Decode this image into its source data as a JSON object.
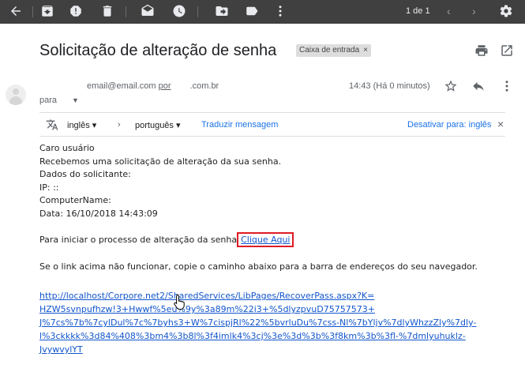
{
  "toolbar": {
    "icons": [
      "back-arrow-icon",
      "archive-icon",
      "report-spam-icon",
      "delete-icon",
      "mark-unread-icon",
      "snooze-icon",
      "move-to-icon",
      "labels-icon",
      "more-icon",
      "settings-icon"
    ],
    "pager": "1 de 1"
  },
  "email": {
    "subject": "Solicitação de alteração de senha",
    "label": "Caixa de entrada",
    "label_remove": "×",
    "sender_email": "email@email.com",
    "sender_via": "por",
    "sender_domain": ".com.br",
    "to_label": "para",
    "time": "14:43 (Há 0 minutos)"
  },
  "translate": {
    "from_lang": "inglês",
    "to_lang": "português",
    "translate_link": "Traduzir mensagem",
    "disable_link": "Desativar para: inglês",
    "close": "×"
  },
  "body": {
    "lines": [
      "Caro usuário",
      "Recebemos uma solicitação de alteração da sua senha.",
      "Dados do solicitante:",
      "IP: ::",
      "ComputerName:",
      "Data: 16/10/2018 14:43:09"
    ],
    "cta_prefix": "Para iniciar o processo de alteração da senha",
    "cta_link": "Clique Aqui",
    "fallback_text": "Se o link acima não funcionar, copie o caminho abaixo para a barra de endereços do seu navegador.",
    "url_lines": [
      "http://localhost/Corpore.net2/SharedServices/LibPages/RecoverPass.aspx?K=",
      "HZW5svnpufhzw!3+Hwwf%5eu%9y%3a89m%22i3+%5dlyzpvuD75757573+",
      "J%7cs%7b%7cylDul%7c%7byhs3+W%7cispjRl%22%5bvrluDu%7css-Nl%7bYljv%7dlyWhzzZly%7dly-",
      "l%3ckkkk%3d84%408%3bm4%3b8l%3f4imlk4%3cj%3e%3d%3b%3f8km%3b%3fl-%7dmlyuhuklz-",
      "JvywvylYT"
    ]
  }
}
